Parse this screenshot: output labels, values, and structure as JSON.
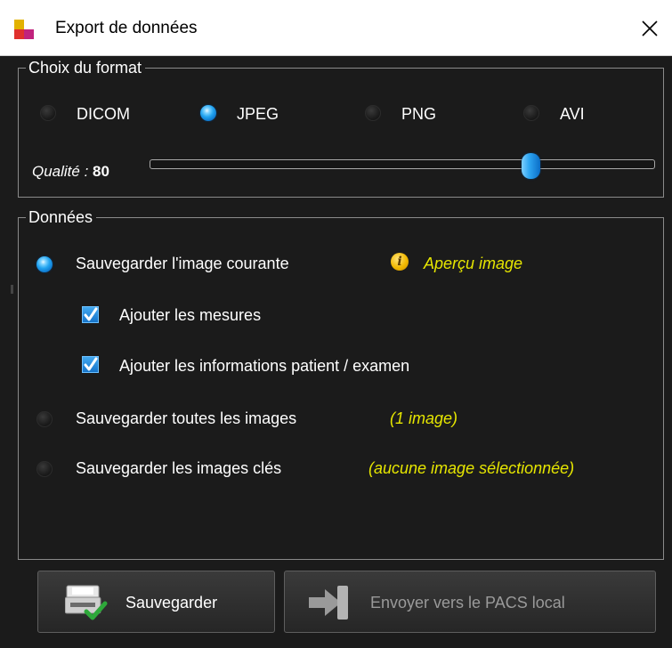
{
  "window": {
    "title": "Export de données",
    "close_icon": "close-icon"
  },
  "format_group": {
    "legend": "Choix du format",
    "options": [
      {
        "label": "DICOM",
        "selected": false
      },
      {
        "label": "JPEG",
        "selected": true
      },
      {
        "label": "PNG",
        "selected": false
      },
      {
        "label": "AVI",
        "selected": false
      }
    ],
    "quality_label": "Qualité : ",
    "quality_value": "80",
    "quality_percent": 80
  },
  "data_group": {
    "legend": "Données",
    "save_current": {
      "label": "Sauvegarder l'image courante",
      "selected": true,
      "preview_icon": "info-icon",
      "preview_hint": "Aperçu image"
    },
    "add_measures": {
      "label": "Ajouter les mesures",
      "checked": true
    },
    "add_patient_info": {
      "label": "Ajouter les informations patient / examen",
      "checked": true
    },
    "save_all": {
      "label": "Sauvegarder toutes les images",
      "selected": false,
      "hint": "(1 image)"
    },
    "save_key": {
      "label": "Sauvegarder les images clés",
      "selected": false,
      "hint": "(aucune image sélectionnée)"
    }
  },
  "buttons": {
    "save_label": "Sauvegarder",
    "save_icon": "save-icon",
    "send_label": "Envoyer vers le PACS local",
    "send_icon": "send-pacs-icon",
    "send_enabled": false
  },
  "colors": {
    "background": "#1b1b1b",
    "accent_blue": "#22a4f0",
    "hint_yellow": "#e6e600",
    "disabled_text": "#9a9a9a"
  }
}
